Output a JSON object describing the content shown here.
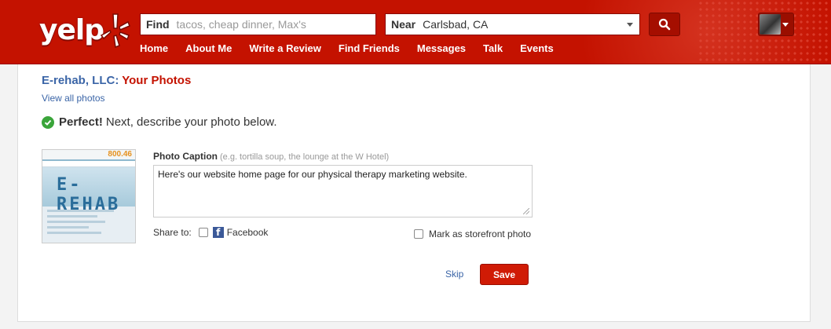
{
  "header": {
    "logo_text": "yelp",
    "find_label": "Find",
    "find_placeholder": "tacos, cheap dinner, Max's",
    "near_label": "Near",
    "near_value": "Carlsbad, CA",
    "nav": [
      "Home",
      "About Me",
      "Write a Review",
      "Find Friends",
      "Messages",
      "Talk",
      "Events"
    ]
  },
  "page": {
    "business_name": "E-rehab, LLC:",
    "title_suffix": "Your Photos",
    "view_all": "View all photos",
    "status_strong": "Perfect!",
    "status_text": "Next, describe your photo below.",
    "thumbnail": {
      "phone": "800.46",
      "brand": "E-REHAB"
    },
    "caption_label": "Photo Caption",
    "caption_hint": "(e.g. tortilla soup, the lounge at the W Hotel)",
    "caption_value": "Here's our website home page for our physical therapy marketing website.",
    "share_label": "Share to:",
    "facebook_label": "Facebook",
    "storefront_label": "Mark as storefront photo",
    "skip_label": "Skip",
    "save_label": "Save"
  },
  "colors": {
    "brand_red": "#c41200",
    "link_blue": "#3b65a7",
    "success_green": "#3aa53a"
  }
}
